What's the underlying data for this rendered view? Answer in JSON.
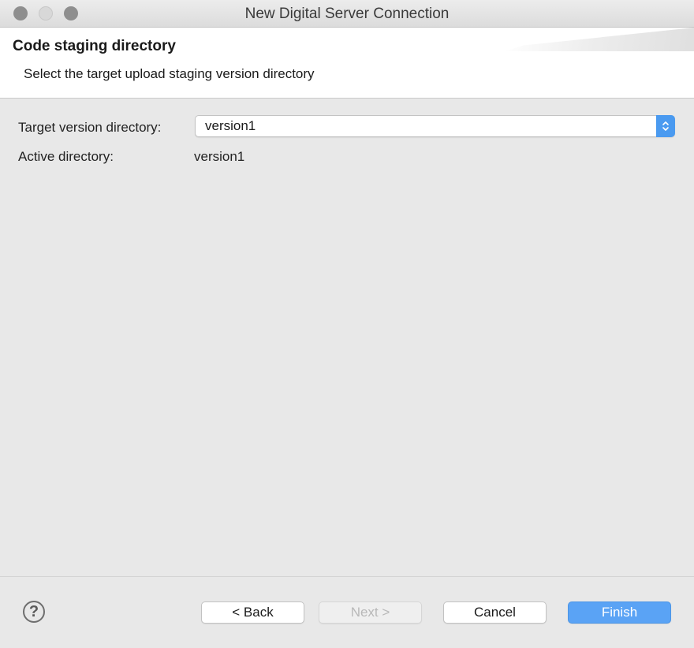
{
  "window": {
    "title": "New Digital Server Connection",
    "controls": [
      "close-button",
      "minimize-button",
      "zoom-button"
    ]
  },
  "banner": {
    "title": "Code staging directory",
    "subtitle": "Select the target upload staging version directory"
  },
  "form": {
    "target_label": "Target version directory:",
    "target_value": "version1",
    "active_label": "Active directory:",
    "active_value": "version1"
  },
  "footer": {
    "help_icon": "?",
    "back_label": "< Back",
    "next_label": "Next >",
    "next_enabled": false,
    "cancel_label": "Cancel",
    "finish_label": "Finish"
  },
  "colors": {
    "accent": "#5aa3f5",
    "background": "#e8e8e8"
  }
}
